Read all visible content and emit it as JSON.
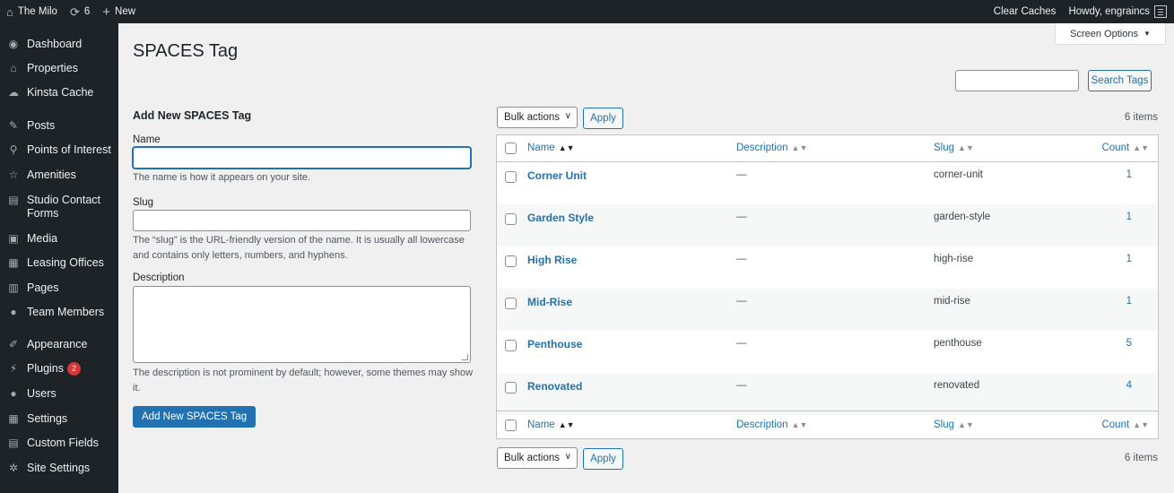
{
  "adminbar": {
    "site_name": "The Milo",
    "updates_count": "6",
    "new_label": "New",
    "clear_caches": "Clear Caches",
    "greeting": "Howdy, engraincs"
  },
  "sidebar": {
    "items": [
      {
        "label": "Dashboard",
        "icon": "dashboard-icon"
      },
      {
        "label": "Properties",
        "icon": "properties-icon"
      },
      {
        "label": "Kinsta Cache",
        "icon": "cloud-icon"
      },
      {
        "label": "Posts",
        "icon": "pin-icon"
      },
      {
        "label": "Points of Interest",
        "icon": "location-icon"
      },
      {
        "label": "Amenities",
        "icon": "star-icon"
      },
      {
        "label": "Studio Contact Forms",
        "icon": "calendar-icon"
      },
      {
        "label": "Media",
        "icon": "media-icon"
      },
      {
        "label": "Leasing Offices",
        "icon": "office-icon"
      },
      {
        "label": "Pages",
        "icon": "pages-icon"
      },
      {
        "label": "Team Members",
        "icon": "person-icon"
      },
      {
        "label": "Appearance",
        "icon": "brush-icon"
      },
      {
        "label": "Plugins",
        "icon": "plugin-icon",
        "badge": "2"
      },
      {
        "label": "Users",
        "icon": "users-icon"
      },
      {
        "label": "Settings",
        "icon": "settings-icon"
      },
      {
        "label": "Custom Fields",
        "icon": "fields-icon"
      },
      {
        "label": "Site Settings",
        "icon": "gear-icon"
      }
    ]
  },
  "page": {
    "title": "SPACES Tag",
    "screen_options": "Screen Options",
    "search_button": "Search Tags"
  },
  "form": {
    "heading": "Add New SPACES Tag",
    "name_label": "Name",
    "name_help": "The name is how it appears on your site.",
    "slug_label": "Slug",
    "slug_help": "The “slug” is the URL-friendly version of the name. It is usually all lowercase and contains only letters, numbers, and hyphens.",
    "description_label": "Description",
    "description_help": "The description is not prominent by default; however, some themes may show it.",
    "submit_label": "Add New SPACES Tag"
  },
  "list": {
    "bulk_actions": "Bulk actions",
    "apply": "Apply",
    "items_count": "6 items",
    "columns": {
      "name": "Name",
      "description": "Description",
      "slug": "Slug",
      "count": "Count"
    },
    "rows": [
      {
        "name": "Corner Unit",
        "description": "—",
        "slug": "corner-unit",
        "count": "1"
      },
      {
        "name": "Garden Style",
        "description": "—",
        "slug": "garden-style",
        "count": "1"
      },
      {
        "name": "High Rise",
        "description": "—",
        "slug": "high-rise",
        "count": "1"
      },
      {
        "name": "Mid-Rise",
        "description": "—",
        "slug": "mid-rise",
        "count": "1"
      },
      {
        "name": "Penthouse",
        "description": "—",
        "slug": "penthouse",
        "count": "5"
      },
      {
        "name": "Renovated",
        "description": "—",
        "slug": "renovated",
        "count": "4"
      }
    ]
  },
  "colors": {
    "admin_dark": "#1d2327",
    "link_blue": "#2271b1",
    "background": "#f0f0f1",
    "badge_red": "#d63638"
  }
}
